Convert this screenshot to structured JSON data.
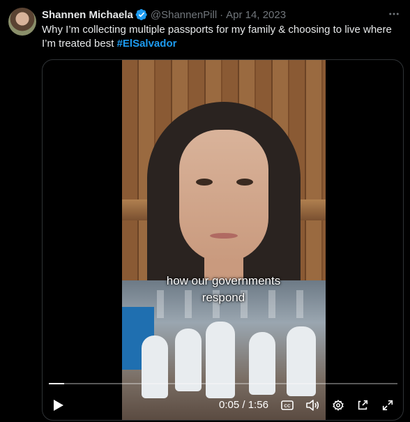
{
  "author": {
    "name": "Shannen Michaela",
    "handle": "@ShannenPill",
    "separator": "·",
    "date": "Apr 14, 2023",
    "verified": true,
    "avatar_icon": "profile-photo"
  },
  "tweet": {
    "text": "Why I’m collecting multiple passports for my family & choosing to live where I’m treated best ",
    "hashtag": "#ElSalvador",
    "hashtag_color": "#1d9bf0"
  },
  "video": {
    "caption_line1": "how our governments",
    "caption_line2": "respond",
    "current_time": "0:05",
    "time_separator": "/",
    "duration": "1:56",
    "progress": 0.043,
    "controls": {
      "play_icon": "play-icon",
      "captions_icon": "closed-captions-icon",
      "volume_icon": "volume-icon",
      "settings_icon": "settings-gear-icon",
      "popout_icon": "pop-out-icon",
      "fullscreen_icon": "fullscreen-icon"
    }
  },
  "colors": {
    "background": "#000000",
    "text": "#e7e9ea",
    "secondary_text": "#71767b",
    "verified_badge": "#1d9bf0"
  }
}
